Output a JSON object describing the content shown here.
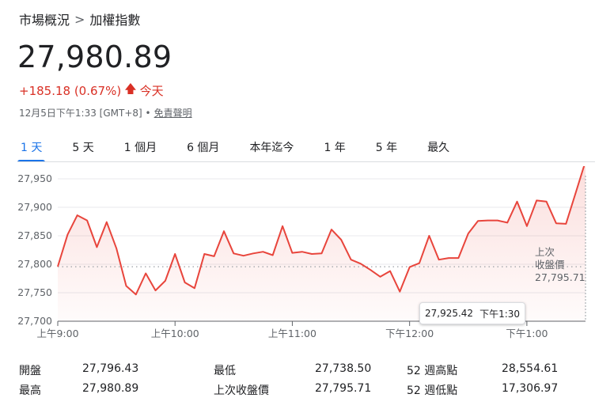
{
  "breadcrumb": {
    "parent": "市場概況",
    "separator": ">",
    "current": "加權指數"
  },
  "price": "27,980.89",
  "change": {
    "text": "+185.18 (0.67%)",
    "arrow": "🡅",
    "period": "今天"
  },
  "timestamp": {
    "text": "12月5日下午1:33 [GMT+8] •",
    "disclaimer": "免責聲明"
  },
  "tabs": [
    {
      "label": "1 天",
      "active": true
    },
    {
      "label": "5 天",
      "active": false
    },
    {
      "label": "1 個月",
      "active": false
    },
    {
      "label": "6 個月",
      "active": false
    },
    {
      "label": "本年迄今",
      "active": false
    },
    {
      "label": "1 年",
      "active": false
    },
    {
      "label": "5 年",
      "active": false
    },
    {
      "label": "最久",
      "active": false
    }
  ],
  "tooltip": {
    "value": "27,925.42",
    "time": "下午1:30"
  },
  "prev_close_label": {
    "line1": "上次",
    "line2": "收盤價",
    "value": "27,795.71"
  },
  "stats": {
    "open_label": "開盤",
    "open": "27,796.43",
    "high_label": "最高",
    "high": "27,980.89",
    "low_label": "最低",
    "low": "27,738.50",
    "prev_close_label": "上次收盤價",
    "prev_close": "27,795.71",
    "wk52_high_label": "52 週高點",
    "wk52_high": "28,554.61",
    "wk52_low_label": "52 週低點",
    "wk52_low": "17,306.97"
  },
  "colors": {
    "line": "#e8453c",
    "fill": "#fce8e6",
    "accent": "#1a73e8",
    "negative": "#d93025"
  },
  "chart_data": {
    "type": "area",
    "title": "",
    "xlabel": "",
    "ylabel": "",
    "ylim": [
      27700,
      27950
    ],
    "yticks": [
      27700,
      27750,
      27800,
      27850,
      27900,
      27950
    ],
    "ytick_labels": [
      "27,700",
      "27,750",
      "27,800",
      "27,850",
      "27,900",
      "27,950"
    ],
    "xlim": [
      0,
      270
    ],
    "xticks": [
      0,
      60,
      120,
      180,
      240
    ],
    "xtick_labels": [
      "上午9:00",
      "上午10:00",
      "上午11:00",
      "下午12:00",
      "下午1:00"
    ],
    "baseline": 27795.71,
    "grid": true,
    "series": [
      {
        "x": [
          0,
          5,
          10,
          15,
          20,
          25,
          30,
          35,
          40,
          45,
          50,
          55,
          60,
          65,
          70,
          75,
          80,
          85,
          90,
          95,
          100,
          105,
          110,
          115,
          120,
          125,
          130,
          135,
          140,
          145,
          150,
          155,
          160,
          165,
          170,
          175,
          180,
          185,
          190,
          195,
          200,
          205,
          210,
          215,
          220,
          225,
          230,
          235,
          240,
          245,
          250,
          255,
          260,
          265
        ],
        "y": [
          27796,
          27852,
          27886,
          27877,
          27830,
          27874,
          27828,
          27762,
          27747,
          27784,
          27754,
          27771,
          27818,
          27768,
          27758,
          27818,
          27814,
          27858,
          27819,
          27815,
          27819,
          27822,
          27816,
          27867,
          27820,
          27822,
          27818,
          27819,
          27861,
          27843,
          27808,
          27801,
          27790,
          27778,
          27788,
          27752,
          27795,
          27802,
          27850,
          27808,
          27811,
          27811,
          27854,
          27876,
          27877,
          27877,
          27873,
          27910,
          27867,
          27912,
          27910,
          27872,
          27871,
          27925.42
        ]
      }
    ],
    "last_point": {
      "x": 270,
      "y": 27980.89
    }
  }
}
